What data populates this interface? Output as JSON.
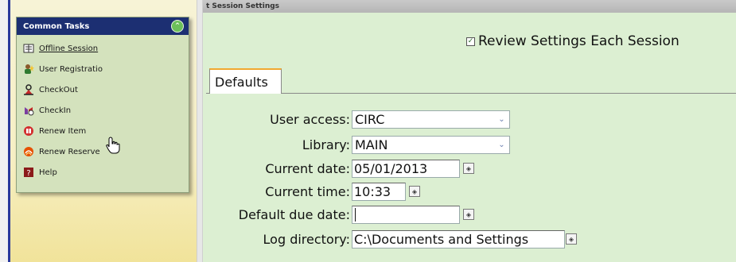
{
  "sidebar": {
    "panel_title": "Common Tasks",
    "items": [
      {
        "label": "Offline Session",
        "icon": "offline-session-icon"
      },
      {
        "label": "User Registratio",
        "icon": "user-registration-icon"
      },
      {
        "label": "CheckOut",
        "icon": "checkout-icon"
      },
      {
        "label": "CheckIn",
        "icon": "checkin-icon"
      },
      {
        "label": "Renew Item",
        "icon": "renew-item-icon"
      },
      {
        "label": "Renew Reserve",
        "icon": "renew-reserve-icon"
      },
      {
        "label": "Help",
        "icon": "help-icon"
      }
    ]
  },
  "window": {
    "title": "t Session Settings"
  },
  "review": {
    "label": "Review Settings Each Session",
    "checked": true
  },
  "tabs": [
    {
      "label": "Defaults",
      "active": true
    }
  ],
  "form": {
    "user_access": {
      "label": "User access:",
      "value": "CIRC"
    },
    "library": {
      "label": "Library:",
      "value": "MAIN"
    },
    "current_date": {
      "label": "Current date:",
      "value": "05/01/2013"
    },
    "current_time": {
      "label": "Current time:",
      "value": "10:33"
    },
    "default_due_date": {
      "label": "Default due date:",
      "value": ""
    },
    "log_directory": {
      "label": "Log directory:",
      "value": "C:\\Documents and Settings"
    }
  },
  "colors": {
    "panel_header": "#1c2f72",
    "panel_bg": "#d4e2bd",
    "main_bg": "#dcefd2",
    "tab_accent": "#f0a830"
  }
}
